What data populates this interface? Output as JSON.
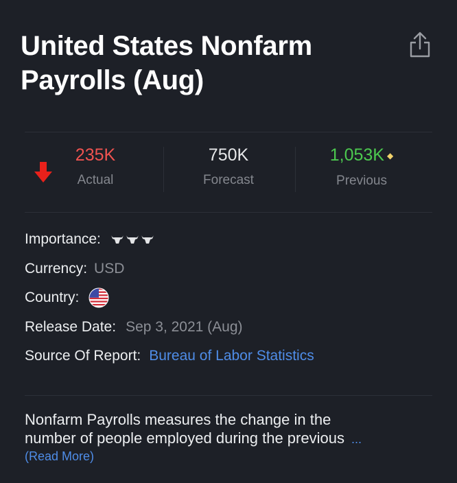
{
  "header": {
    "title": "United States Nonfarm Payrolls (Aug)"
  },
  "stats": {
    "actual": {
      "value": "235K",
      "label": "Actual"
    },
    "forecast": {
      "value": "750K",
      "label": "Forecast"
    },
    "previous": {
      "value": "1,053K",
      "label": "Previous",
      "marker": "◆"
    }
  },
  "details": {
    "importance_label": "Importance:",
    "importance_level": 3,
    "currency_label": "Currency:",
    "currency_value": "USD",
    "country_label": "Country:",
    "country_flag": "us-flag",
    "release_label": "Release Date:",
    "release_value": "Sep 3, 2021 (Aug)",
    "source_label": "Source Of Report:",
    "source_value": "Bureau of Labor Statistics"
  },
  "description": {
    "line1": "Nonfarm Payrolls measures the change in the",
    "line2": "number of people employed during the previous",
    "ellipsis": "...",
    "read_more": "(Read More)"
  },
  "colors": {
    "background": "#1d2027",
    "actual": "#f05350",
    "previous": "#4cc94f",
    "link": "#4f8de8",
    "arrow": "#e8211b"
  },
  "icons": {
    "share": "share-icon",
    "trend": "arrow-down-icon",
    "importance": "bull-icon"
  }
}
